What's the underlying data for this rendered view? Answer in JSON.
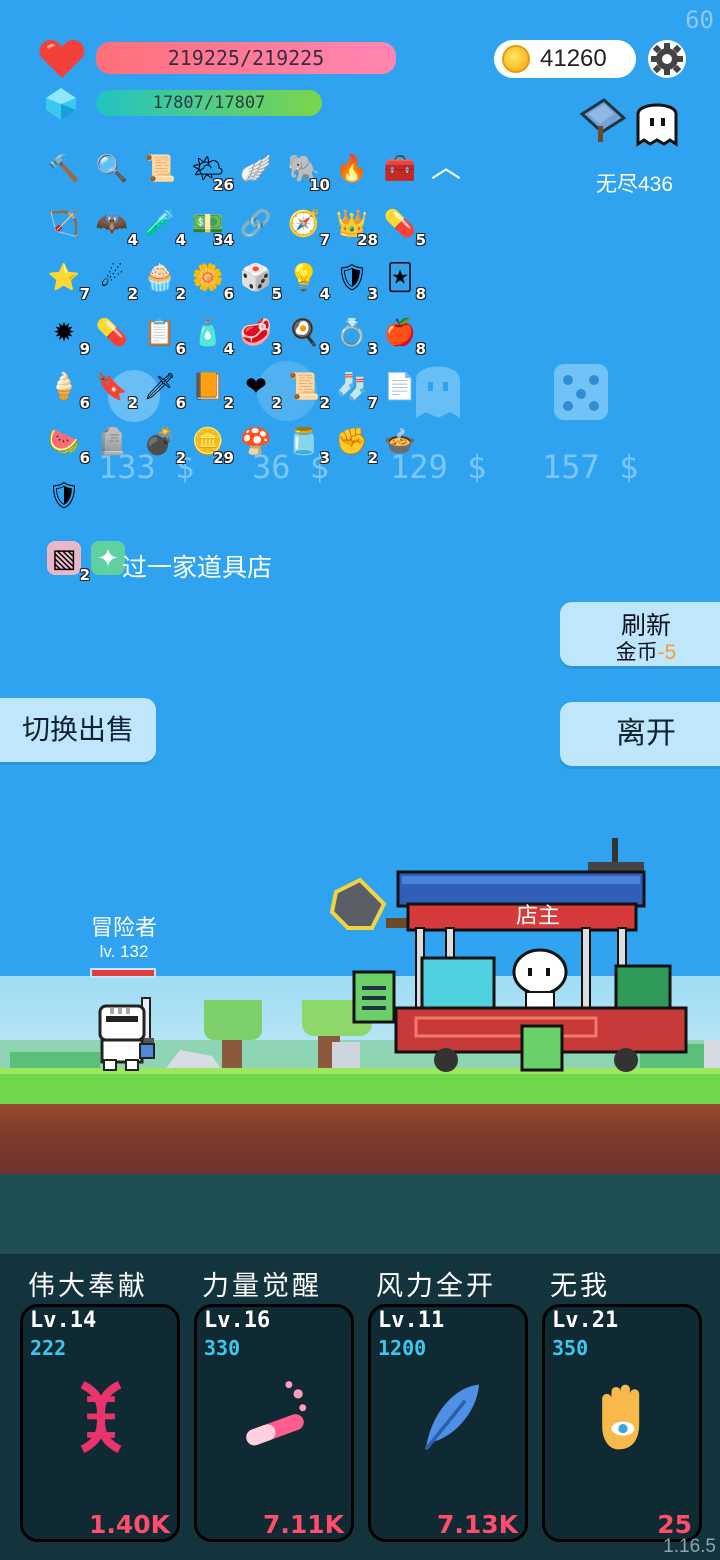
{
  "hud": {
    "fps": "60",
    "hp_text": "219225/219225",
    "mp_text": "17807/17807",
    "coins": "41260",
    "endless_label": "无尽436"
  },
  "items": [
    {
      "icon": "mace-icon",
      "glyph": "🔨",
      "count": ""
    },
    {
      "icon": "magnifier-icon",
      "glyph": "🔍",
      "count": ""
    },
    {
      "icon": "scroll-icon",
      "glyph": "📜",
      "count": ""
    },
    {
      "icon": "sun-cloud-icon",
      "glyph": "🌤",
      "count": "26"
    },
    {
      "icon": "wing-icon",
      "glyph": "🪽",
      "count": ""
    },
    {
      "icon": "elephant-icon",
      "glyph": "🐘",
      "count": "10"
    },
    {
      "icon": "torch-icon",
      "glyph": "🔥",
      "count": ""
    },
    {
      "icon": "treasure-chest-icon",
      "glyph": "🧰",
      "count": ""
    },
    {
      "icon": "crossbow-icon",
      "glyph": "🏹",
      "count": ""
    },
    {
      "icon": "bat-icon",
      "glyph": "🦇",
      "count": "4"
    },
    {
      "icon": "potion-flask-icon",
      "glyph": "🧪",
      "count": "4"
    },
    {
      "icon": "money-heart-icon",
      "glyph": "💵",
      "count": "34"
    },
    {
      "icon": "chain-icon",
      "glyph": "🔗",
      "count": ""
    },
    {
      "icon": "compass-icon",
      "glyph": "🧭",
      "count": "7"
    },
    {
      "icon": "crown-icon",
      "glyph": "👑",
      "count": "28"
    },
    {
      "icon": "pill-icon",
      "glyph": "💊",
      "count": "5"
    },
    {
      "icon": "star-card-icon",
      "glyph": "⭐",
      "count": "7"
    },
    {
      "icon": "meteor-icon",
      "glyph": "☄",
      "count": "2"
    },
    {
      "icon": "cake-icon",
      "glyph": "🧁",
      "count": "2"
    },
    {
      "icon": "flower-icon",
      "glyph": "🌼",
      "count": "6"
    },
    {
      "icon": "dice-icon",
      "glyph": "🎲",
      "count": "5"
    },
    {
      "icon": "bulb-icon",
      "glyph": "💡",
      "count": "4"
    },
    {
      "icon": "shield-round-icon",
      "glyph": "🛡",
      "count": "3"
    },
    {
      "icon": "cards-icon",
      "glyph": "🃏",
      "count": "8"
    },
    {
      "icon": "spiked-ball-icon",
      "glyph": "✹",
      "count": "9"
    },
    {
      "icon": "capsule-icon",
      "glyph": "💊",
      "count": ""
    },
    {
      "icon": "clipboard-icon",
      "glyph": "📋",
      "count": "6"
    },
    {
      "icon": "perfume-icon",
      "glyph": "🧴",
      "count": "4"
    },
    {
      "icon": "steak-icon",
      "glyph": "🥩",
      "count": "3"
    },
    {
      "icon": "egg-icon",
      "glyph": "🍳",
      "count": "9"
    },
    {
      "icon": "ring-icon",
      "glyph": "💍",
      "count": "3"
    },
    {
      "icon": "apple-icon",
      "glyph": "🍎",
      "count": "8"
    },
    {
      "icon": "ice-cream-icon",
      "glyph": "🍦",
      "count": "6"
    },
    {
      "icon": "bookmark-icon",
      "glyph": "🔖",
      "count": "2"
    },
    {
      "icon": "sword-icon",
      "glyph": "🗡",
      "count": "6"
    },
    {
      "icon": "book-icon",
      "glyph": "📙",
      "count": "2"
    },
    {
      "icon": "heart-icon",
      "glyph": "❤",
      "count": "2"
    },
    {
      "icon": "scroll-red-icon",
      "glyph": "📜",
      "count": "2"
    },
    {
      "icon": "sock-icon",
      "glyph": "🧦",
      "count": "7"
    },
    {
      "icon": "paper-scroll-icon",
      "glyph": "📄",
      "count": ""
    },
    {
      "icon": "watermelon-icon",
      "glyph": "🍉",
      "count": "6"
    },
    {
      "icon": "tombstone-icon",
      "glyph": "🪦",
      "count": ""
    },
    {
      "icon": "grenade-icon",
      "glyph": "💣",
      "count": "2"
    },
    {
      "icon": "coin-stack-icon",
      "glyph": "🪙",
      "count": "29"
    },
    {
      "icon": "mushroom-icon",
      "glyph": "🍄",
      "count": ""
    },
    {
      "icon": "jam-jar-icon",
      "glyph": "🫙",
      "count": "3"
    },
    {
      "icon": "fist-icon",
      "glyph": "✊",
      "count": "2"
    },
    {
      "icon": "cauldron-icon",
      "glyph": "🍲",
      "count": ""
    },
    {
      "icon": "shield-icon",
      "glyph": "🛡",
      "count": ""
    }
  ],
  "event": {
    "items": [
      {
        "icon": "striped-card-icon",
        "glyph": "▧",
        "count": "2"
      },
      {
        "icon": "glow-card-icon",
        "glyph": "✦",
        "count": ""
      }
    ],
    "text": "过一家道具店"
  },
  "shop": {
    "prices": [
      "133 $",
      "36 $",
      "129 $",
      "157 $"
    ]
  },
  "buttons": {
    "refresh_label": "刷新",
    "refresh_cost_prefix": "金币",
    "refresh_cost_value": "-5",
    "leave": "离开",
    "toggle_sell": "切换出售"
  },
  "scene": {
    "adventurer_name": "冒险者",
    "adventurer_level": "lv. 132",
    "shopkeeper_label": "店主"
  },
  "skills": [
    {
      "title": "伟大奉献",
      "level": "Lv.14",
      "value": "222",
      "cost": "1.40K",
      "icon": "dna-icon",
      "color": "#e8336b"
    },
    {
      "title": "力量觉醒",
      "level": "Lv.16",
      "value": "330",
      "cost": "7.11K",
      "icon": "test-tube-icon",
      "color": "#ff5d8f"
    },
    {
      "title": "风力全开",
      "level": "Lv.11",
      "value": "1200",
      "cost": "7.13K",
      "icon": "feather-icon",
      "color": "#4f8fe6"
    },
    {
      "title": "无我",
      "level": "Lv.21",
      "value": "350",
      "cost": "25",
      "icon": "eye-hand-icon",
      "color": "#f6b94a"
    }
  ],
  "version": "1.16.5"
}
